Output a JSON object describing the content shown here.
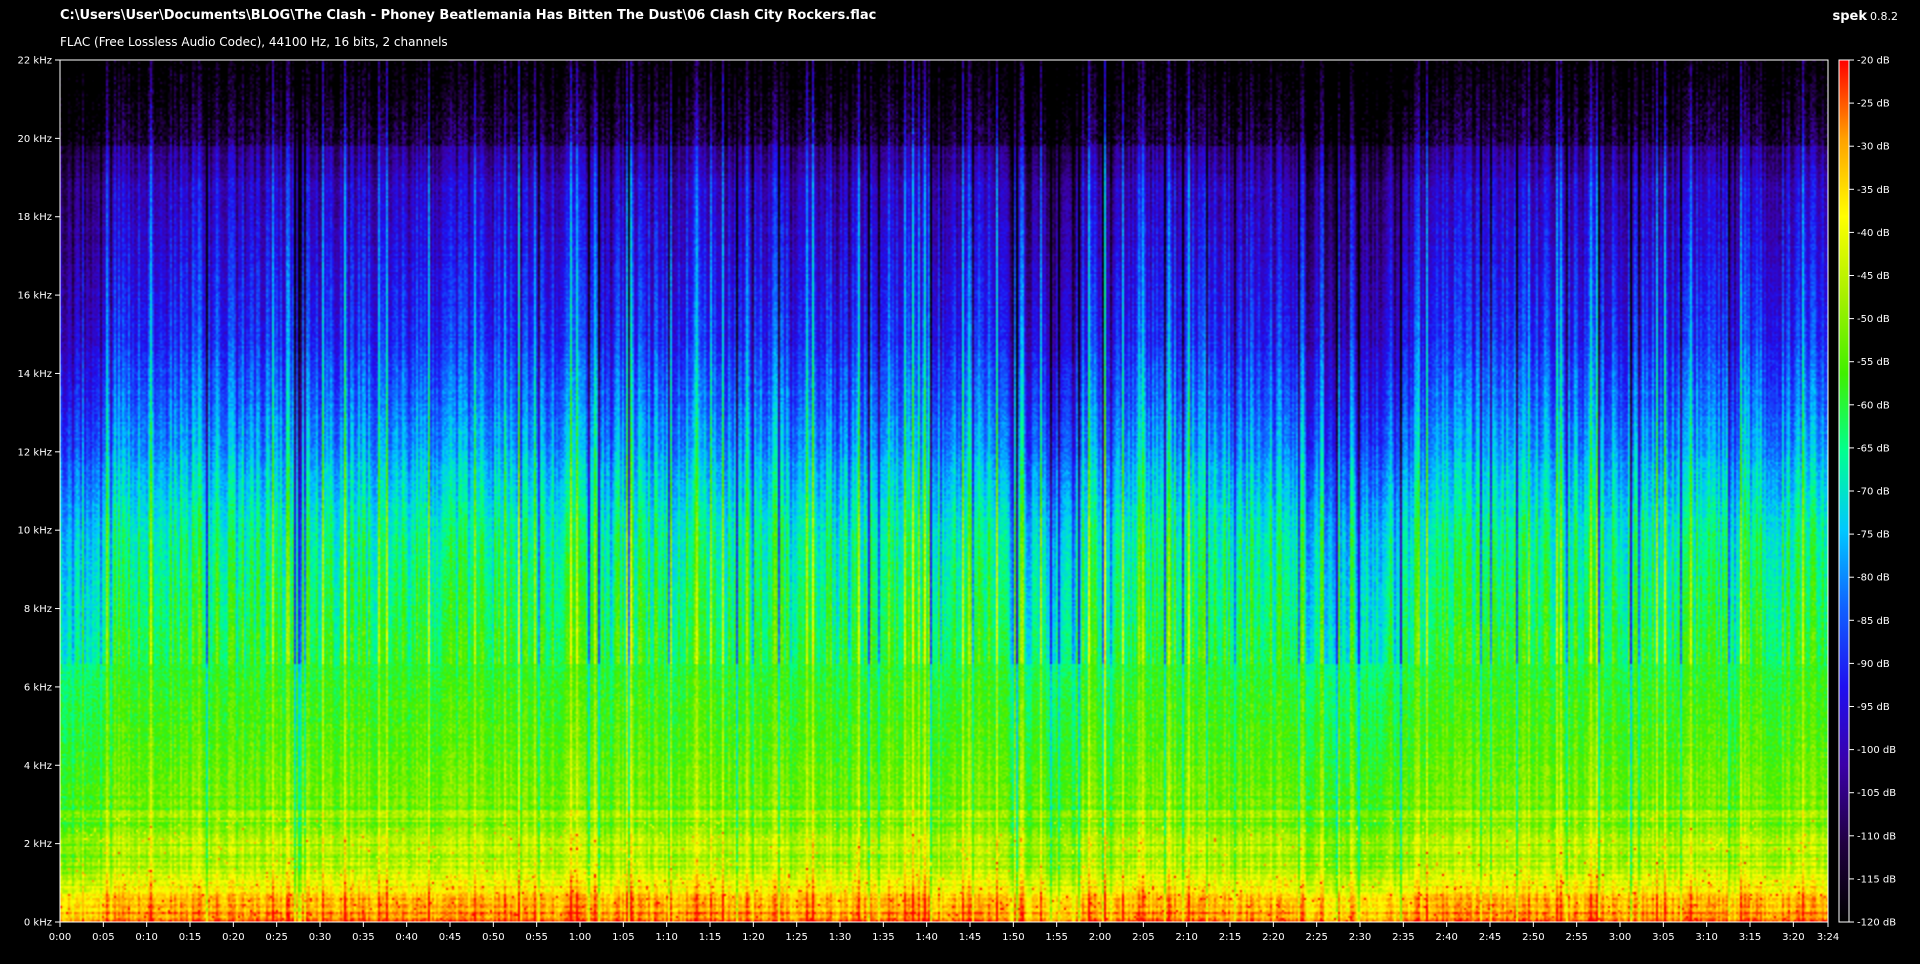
{
  "header": {
    "file_path": "C:\\Users\\User\\Documents\\BLOG\\The Clash - Phoney Beatlemania Has Bitten The Dust\\06 Clash City Rockers.flac",
    "file_info": "FLAC (Free Lossless Audio Codec), 44100 Hz, 16 bits, 2 channels",
    "app_name": "spek",
    "app_version": "0.8.2"
  },
  "chart_data": {
    "type": "heatmap",
    "title": "",
    "xlabel": "",
    "ylabel": "",
    "x_range_seconds": [
      0,
      204
    ],
    "y_range_khz": [
      0,
      22
    ],
    "db_range": [
      -120,
      -20
    ],
    "frequency_ticks": [
      "0 kHz",
      "2 kHz",
      "4 kHz",
      "6 kHz",
      "8 kHz",
      "10 kHz",
      "12 kHz",
      "14 kHz",
      "16 kHz",
      "18 kHz",
      "20 kHz",
      "22 kHz"
    ],
    "time_ticks": [
      "0:00",
      "0:05",
      "0:10",
      "0:15",
      "0:20",
      "0:25",
      "0:30",
      "0:35",
      "0:40",
      "0:45",
      "0:50",
      "0:55",
      "1:00",
      "1:05",
      "1:10",
      "1:15",
      "1:20",
      "1:25",
      "1:30",
      "1:35",
      "1:40",
      "1:45",
      "1:50",
      "1:55",
      "2:00",
      "2:05",
      "2:10",
      "2:15",
      "2:20",
      "2:25",
      "2:30",
      "2:35",
      "2:40",
      "2:45",
      "2:50",
      "2:55",
      "3:00",
      "3:05",
      "3:10",
      "3:15",
      "3:20",
      "3:24"
    ],
    "db_ticks": [
      "-20 dB",
      "-25 dB",
      "-30 dB",
      "-35 dB",
      "-40 dB",
      "-45 dB",
      "-50 dB",
      "-55 dB",
      "-60 dB",
      "-65 dB",
      "-70 dB",
      "-75 dB",
      "-80 dB",
      "-85 dB",
      "-90 dB",
      "-95 dB",
      "-100 dB",
      "-105 dB",
      "-110 dB",
      "-115 dB",
      "-120 dB"
    ],
    "colorbar_stops": [
      "#000000",
      "#200040",
      "#3a00a8",
      "#2010f0",
      "#1060ff",
      "#00c8ff",
      "#00ff90",
      "#40f000",
      "#a8f000",
      "#ffff00",
      "#ffa000",
      "#ff0000"
    ],
    "grid": false,
    "legend": "colorbar-right"
  }
}
